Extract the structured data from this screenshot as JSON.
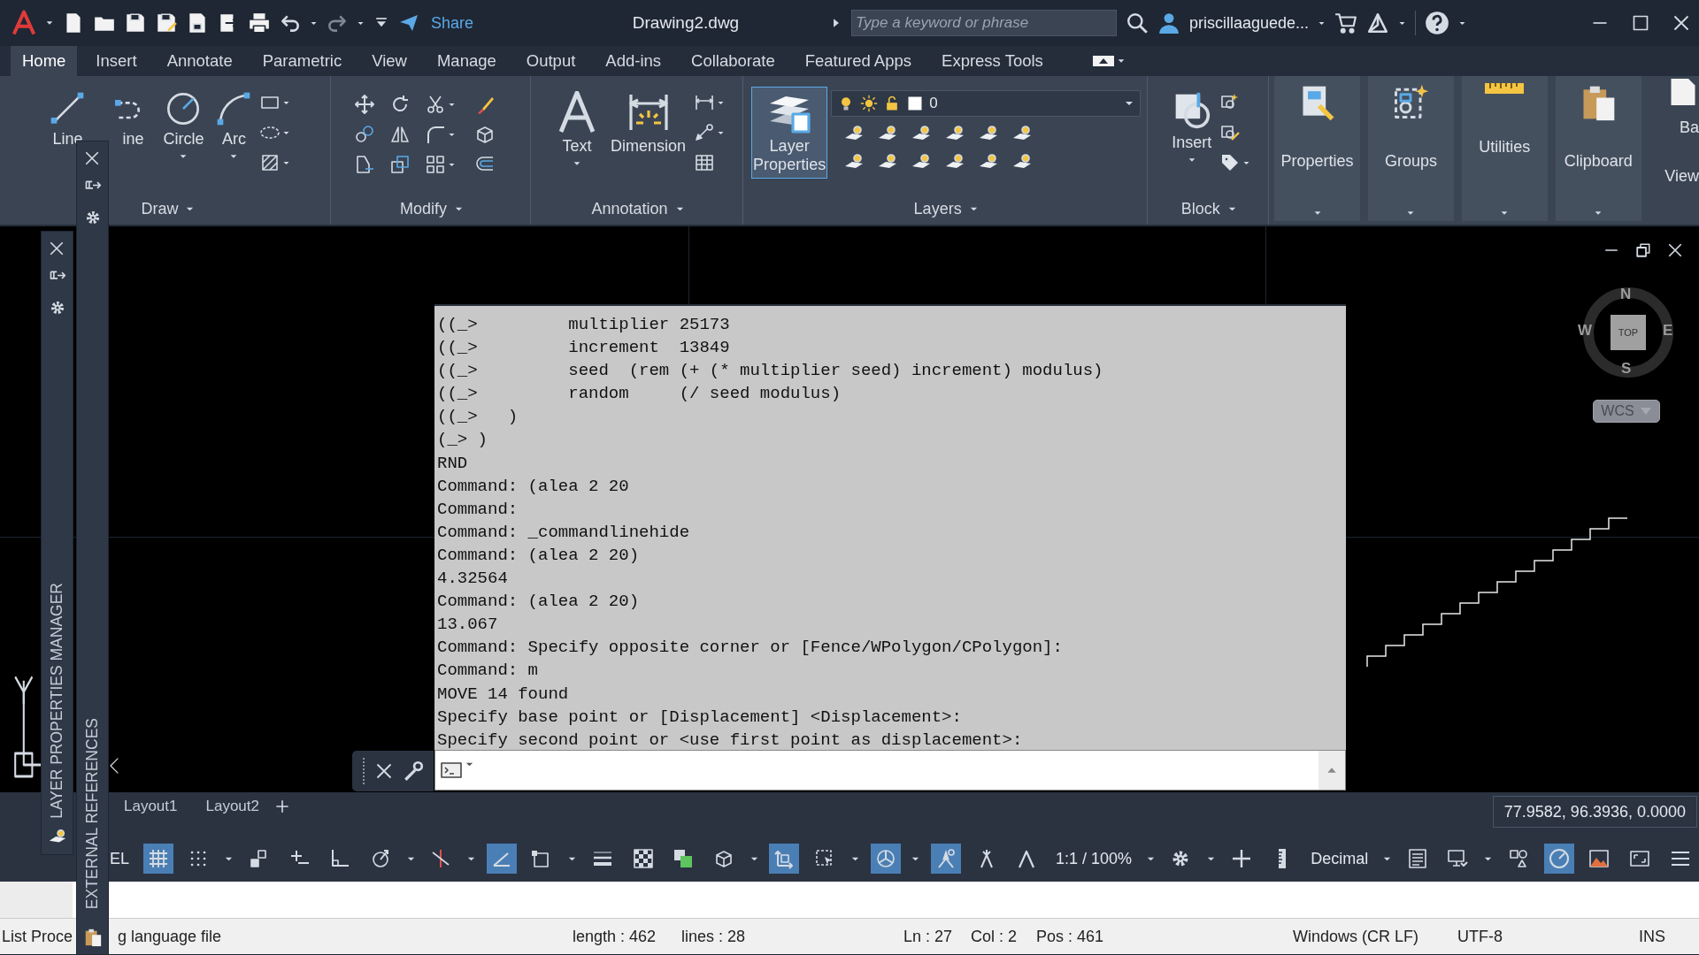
{
  "title_bar": {
    "share": "Share",
    "title": "Drawing2.dwg",
    "search": {
      "placeholder": "Type a keyword or phrase"
    },
    "user": "priscillaaguede..."
  },
  "ribbon_tabs": [
    {
      "label": "Home",
      "selected": true
    },
    {
      "label": "Insert",
      "selected": false
    },
    {
      "label": "Annotate",
      "selected": false
    },
    {
      "label": "Parametric",
      "selected": false
    },
    {
      "label": "View",
      "selected": false
    },
    {
      "label": "Manage",
      "selected": false
    },
    {
      "label": "Output",
      "selected": false
    },
    {
      "label": "Add-ins",
      "selected": false
    },
    {
      "label": "Collaborate",
      "selected": false
    },
    {
      "label": "Featured Apps",
      "selected": false
    },
    {
      "label": "Express Tools",
      "selected": false
    }
  ],
  "ribbon_panels": [
    {
      "kind": "draw",
      "title": "Draw",
      "menu": true,
      "tools": [
        {
          "label": "Line",
          "kind": "line",
          "menu": false,
          "highlighted": false
        },
        {
          "label": "ine",
          "kind": "polyline",
          "menu": false,
          "highlighted": false
        },
        {
          "label": "Circle",
          "kind": "circle",
          "menu": true,
          "highlighted": false
        },
        {
          "label": "Arc",
          "kind": "arc",
          "menu": true,
          "highlighted": false
        }
      ]
    },
    {
      "kind": "modify",
      "title": "Modify",
      "menu": true
    },
    {
      "kind": "annotation",
      "title": "Annotation",
      "menu": true,
      "tools": [
        {
          "label": "Text",
          "kind": "text",
          "menu": true,
          "highlighted": false
        },
        {
          "label": "Dimension",
          "kind": "dimension",
          "menu": false,
          "highlighted": false
        }
      ]
    },
    {
      "kind": "layers",
      "title": "Layers",
      "menu": true,
      "layer": "0",
      "tools": [
        {
          "label": "Layer Properties",
          "kind": "layerprops",
          "menu": false,
          "highlighted": true
        }
      ]
    },
    {
      "kind": "block",
      "title": "Block",
      "menu": true,
      "tools": [
        {
          "label": "Insert",
          "kind": "insert",
          "menu": true,
          "highlighted": false
        }
      ]
    },
    {
      "kind": "collapsed",
      "label": "Properties"
    },
    {
      "kind": "collapsed",
      "label": "Groups"
    },
    {
      "kind": "collapsed",
      "label": "Utilities"
    },
    {
      "kind": "collapsed",
      "label": "Clipboard"
    },
    {
      "kind": "cut",
      "label": "Ba",
      "title": "View"
    }
  ],
  "palettes": [
    {
      "title": "LAYER PROPERTIES MANAGER"
    },
    {
      "title": "EXTERNAL REFERENCES"
    }
  ],
  "viewcube": {
    "north": "N",
    "south": "S",
    "east": "E",
    "west": "W",
    "face": "TOP",
    "ucs": "WCS"
  },
  "command_window": {
    "history": [
      "((_>         multiplier 25173",
      "((_>         increment  13849",
      "((_>         seed  (rem (+ (* multiplier seed) increment) modulus)",
      "((_>         random     (/ seed modulus)",
      "((_>   )",
      "(_> )",
      "RND",
      "Command: (alea 2 20",
      "Command:",
      "Command: _commandlinehide",
      "Command: (alea 2 20)",
      "4.32564",
      "Command: (alea 2 20)",
      "13.067",
      "Command: Specify opposite corner or [Fence/WPolygon/CPolygon]:",
      "Command: m",
      "MOVE 14 found",
      "Specify base point or [Displacement] <Displacement>:",
      "Specify second point or <use first point as displacement>:"
    ]
  },
  "layout_tabs": [
    {
      "label": "Layout1"
    },
    {
      "label": "Layout2"
    }
  ],
  "coordinates": "77.9582, 96.3936, 0.0000",
  "status_bar": {
    "items": [
      {
        "kind": "text",
        "text": "EL"
      },
      {
        "kind": "grid",
        "on": true
      },
      {
        "kind": "dots",
        "on": false
      },
      {
        "kind": "caret"
      },
      {
        "kind": "snap",
        "on": false
      },
      {
        "kind": "infer",
        "on": false
      },
      {
        "kind": "ortho",
        "on": false
      },
      {
        "kind": "polar",
        "on": false
      },
      {
        "kind": "caret"
      },
      {
        "kind": "iso",
        "on": false
      },
      {
        "kind": "caret"
      },
      {
        "kind": "angle",
        "on": true
      },
      {
        "kind": "box",
        "on": false
      },
      {
        "kind": "caret"
      },
      {
        "kind": "lineweight",
        "on": false
      },
      {
        "kind": "checker",
        "on": false
      },
      {
        "kind": "cycle",
        "on": false
      },
      {
        "kind": "cube",
        "on": false
      },
      {
        "kind": "caret"
      },
      {
        "kind": "dynucs",
        "on": true
      },
      {
        "kind": "select",
        "on": false
      },
      {
        "kind": "caret"
      },
      {
        "kind": "gizmo",
        "on": true
      },
      {
        "kind": "caret"
      },
      {
        "kind": "annot",
        "on": true
      },
      {
        "kind": "annot2",
        "on": false
      },
      {
        "kind": "annot3",
        "on": false
      },
      {
        "kind": "text",
        "text": "1:1 / 100%"
      },
      {
        "kind": "caret"
      },
      {
        "kind": "gear",
        "on": false
      },
      {
        "kind": "caret"
      },
      {
        "kind": "plus",
        "on": false
      },
      {
        "kind": "units",
        "on": false
      },
      {
        "kind": "text",
        "text": "Decimal"
      },
      {
        "kind": "caret"
      },
      {
        "kind": "quickprops",
        "on": false
      },
      {
        "kind": "monitor",
        "on": false
      },
      {
        "kind": "caret"
      },
      {
        "kind": "isolate",
        "on": false
      },
      {
        "kind": "gauge",
        "on": true
      },
      {
        "kind": "image",
        "on": false
      },
      {
        "kind": "fullscreen",
        "on": false
      },
      {
        "kind": "menu",
        "on": false
      }
    ]
  },
  "editor_status": [
    "List Proce",
    "g language file",
    "length : 462",
    "lines : 28",
    "Ln : 27",
    "Col : 2",
    "Pos : 461",
    "Windows (CR LF)",
    "UTF-8",
    "INS"
  ]
}
